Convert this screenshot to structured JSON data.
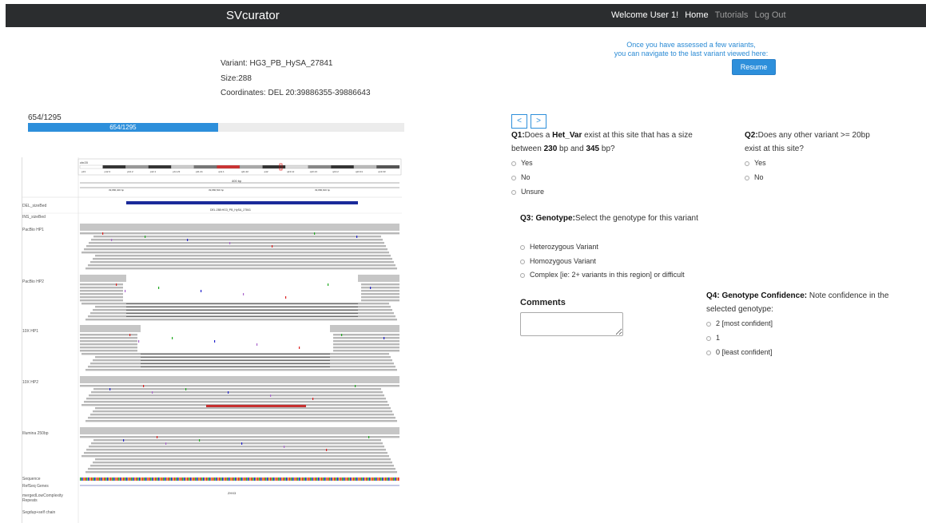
{
  "navbar": {
    "brand": "SVcurator",
    "welcome": "Welcome User 1!",
    "home": "Home",
    "tutorials": "Tutorials",
    "logout": "Log Out"
  },
  "variant": {
    "name": "Variant: HG3_PB_HySA_27841",
    "size": "Size:288",
    "coordinates": "Coordinates: DEL 20:39886355-39886643"
  },
  "resume": {
    "line1": "Once you have assessed a few variants,",
    "line2": "you can navigate to the last variant viewed here:",
    "button": "Resume"
  },
  "progress": {
    "label": "654/1295",
    "fill_label": "654/1295",
    "current": 654,
    "total": 1295
  },
  "igv": {
    "chrom": "chr20",
    "bands": [
      "p13",
      "p12.3",
      "p12.2",
      "p12.1",
      "p11.23",
      "p11.21",
      "q11.1",
      "q11.22",
      "q12",
      "q13.12",
      "q13.13",
      "q13.2",
      "q13.31",
      "q13.33"
    ],
    "scale_label": "400 bp",
    "ticks": [
      "39,886,400 bp",
      "39,886,500 bp",
      "39,886,600 bp"
    ],
    "feature_label": "DEL:288:HG3_PB_HySA_27841",
    "gene": "ZHX3",
    "tracks": [
      "DEL_sizeBed",
      "INS_sizeBed",
      "PacBio HP1",
      "PacBio HP2",
      "10X HP1",
      "10X HP2",
      "Illumina 250bp",
      "Sequence",
      "RefSeq Genes",
      "mergedLowComplexity Repeats",
      "Segdup+self chain"
    ]
  },
  "nav": {
    "prev": "<",
    "next": ">"
  },
  "q1": {
    "prefix": "Q1:",
    "text_a": "Does a ",
    "bold_term": "Het_Var",
    "text_b": " exist at this site that has a size between ",
    "min": "230",
    "text_c": " bp and ",
    "max": "345",
    "text_d": " bp?",
    "options": [
      "Yes",
      "No",
      "Unsure"
    ]
  },
  "q2": {
    "prefix": "Q2:",
    "text": "Does any other variant >= 20bp exist at this site?",
    "options": [
      "Yes",
      "No"
    ]
  },
  "q3": {
    "prefix": "Q3: Genotype:",
    "text": "Select the genotype for this variant",
    "options": [
      "Heterozygous Variant",
      "Homozygous Variant",
      "Complex [ie: 2+ variants in this region] or difficult"
    ]
  },
  "comments": {
    "label": "Comments"
  },
  "q4": {
    "prefix": "Q4: Genotype Confidence:",
    "text": " Note confidence in the selected genotype:",
    "options": [
      "2 [most confident]",
      "1",
      "0 [least confident]"
    ]
  },
  "colors": {
    "navbar": "#2b2d2f",
    "accent": "#2d8fdb",
    "link": "#2a8ad4",
    "deletion_bar": "#1a2a9a"
  }
}
